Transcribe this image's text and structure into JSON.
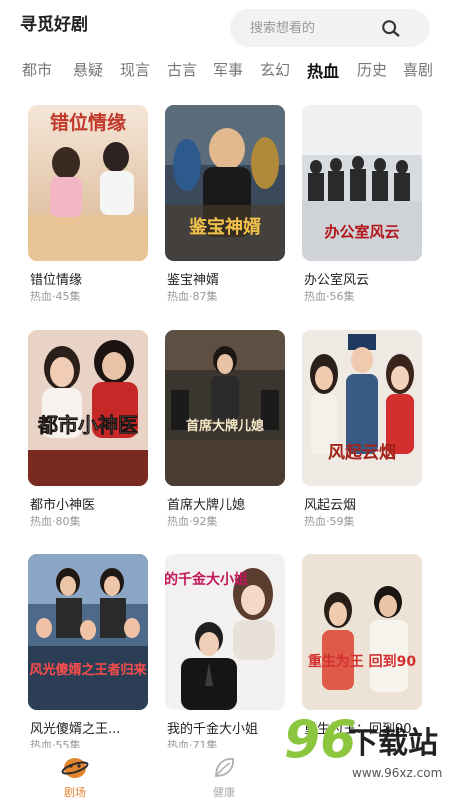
{
  "header": {
    "brand": "寻觅好剧",
    "search_placeholder": "搜索想看的"
  },
  "tabs": [
    "都市",
    "悬疑",
    "现言",
    "古言",
    "军事",
    "玄幻",
    "热血",
    "历史",
    "喜剧"
  ],
  "active_tab": "热血",
  "cards": [
    {
      "title": "错位情缘",
      "meta": "热血·45集",
      "poster_text": "错位情缘"
    },
    {
      "title": "鉴宝神婿",
      "meta": "热血·87集",
      "poster_text": "鉴宝神婿"
    },
    {
      "title": "办公室风云",
      "meta": "热血·56集",
      "poster_text": "办公室风云"
    },
    {
      "title": "都市小神医",
      "meta": "热血·80集",
      "poster_text": "都市小神医"
    },
    {
      "title": "首席大牌儿媳",
      "meta": "热血·92集",
      "poster_text": "首席大牌儿媳"
    },
    {
      "title": "风起云烟",
      "meta": "热血·59集",
      "poster_text": "风起云烟"
    },
    {
      "title": "风光傻婿之王...",
      "meta": "热血·55集",
      "poster_text": "风光傻婿之王者归来"
    },
    {
      "title": "我的千金大小姐",
      "meta": "热血·71集",
      "poster_text": "我的千金大小姐"
    },
    {
      "title": "重生为王：回到90",
      "meta": "",
      "poster_text": "重生为王 回到90"
    }
  ],
  "bottom_nav": [
    {
      "label": "剧场",
      "icon": "theater-icon",
      "active": true
    },
    {
      "label": "健康",
      "icon": "leaf-icon",
      "active": false
    }
  ],
  "watermark": {
    "number": "96",
    "text": "下载站",
    "url": "www.96xz.com"
  },
  "colors": {
    "accent": "#e3852e",
    "active_tab": "#111111",
    "inactive_tab": "#777777",
    "meta": "#999999"
  }
}
